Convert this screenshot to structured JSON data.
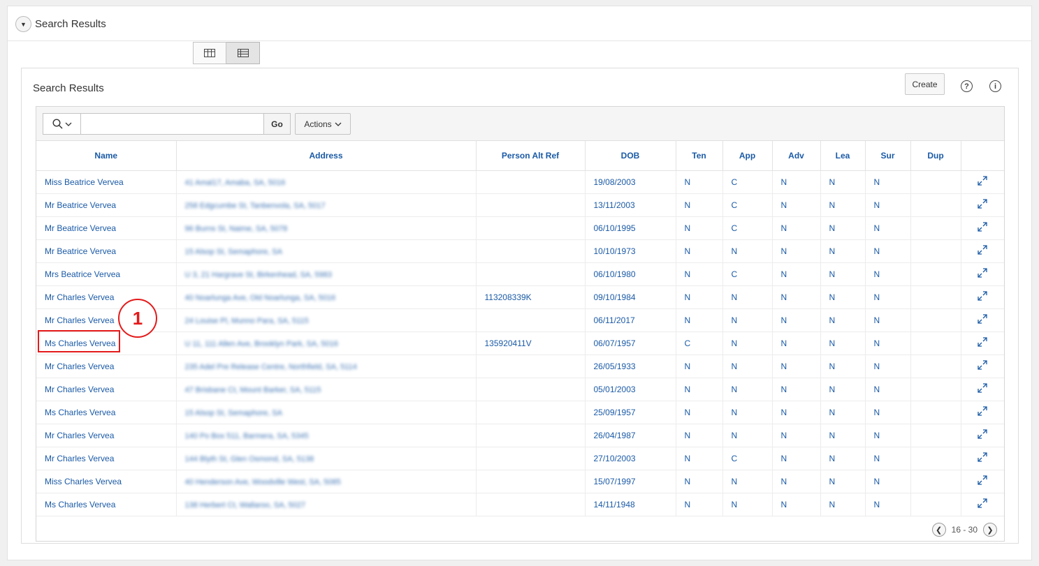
{
  "region": {
    "title": "Search Results"
  },
  "report": {
    "title": "Search Results",
    "create_label": "Create",
    "help_glyph": "?",
    "info_glyph": "i",
    "go_label": "Go",
    "actions_label": "Actions",
    "search_value": "",
    "columns": [
      "Name",
      "Address",
      "Person Alt Ref",
      "DOB",
      "Ten",
      "App",
      "Adv",
      "Lea",
      "Sur",
      "Dup",
      ""
    ],
    "rows": [
      {
        "name": "Miss Beatrice Vervea",
        "address": "41 Amal17, Amaba, SA, 5016",
        "alt_ref": "",
        "dob": "19/08/2003",
        "ten": "N",
        "app": "C",
        "adv": "N",
        "lea": "N",
        "sur": "N",
        "dup": ""
      },
      {
        "name": "Mr Beatrice Vervea",
        "address": "258 Edgcumbe St, Tanbenvola, SA, 5017",
        "alt_ref": "",
        "dob": "13/11/2003",
        "ten": "N",
        "app": "C",
        "adv": "N",
        "lea": "N",
        "sur": "N",
        "dup": ""
      },
      {
        "name": "Mr Beatrice Vervea",
        "address": "96 Burns St, Naime, SA, 5078",
        "alt_ref": "",
        "dob": "06/10/1995",
        "ten": "N",
        "app": "C",
        "adv": "N",
        "lea": "N",
        "sur": "N",
        "dup": ""
      },
      {
        "name": "Mr Beatrice Vervea",
        "address": "15 Alsop St, Semaphore, SA",
        "alt_ref": "",
        "dob": "10/10/1973",
        "ten": "N",
        "app": "N",
        "adv": "N",
        "lea": "N",
        "sur": "N",
        "dup": ""
      },
      {
        "name": "Mrs Beatrice Vervea",
        "address": "U 3, 21 Hargrave St, Birkenhead, SA, 5983",
        "alt_ref": "",
        "dob": "06/10/1980",
        "ten": "N",
        "app": "C",
        "adv": "N",
        "lea": "N",
        "sur": "N",
        "dup": ""
      },
      {
        "name": "Mr Charles Vervea",
        "address": "40 Noarlunga Ave, Old Noarlunga, SA, 5016",
        "alt_ref": "113208339K",
        "dob": "09/10/1984",
        "ten": "N",
        "app": "N",
        "adv": "N",
        "lea": "N",
        "sur": "N",
        "dup": ""
      },
      {
        "name": "Mr Charles Vervea",
        "address": "24 Louise Pl, Munno Para, SA, 5115",
        "alt_ref": "",
        "dob": "06/11/2017",
        "ten": "N",
        "app": "N",
        "adv": "N",
        "lea": "N",
        "sur": "N",
        "dup": ""
      },
      {
        "name": "Ms Charles Vervea",
        "address": "U 11, 111 Allen Ave, Brooklyn Park, SA, 5016",
        "alt_ref": "135920411V",
        "dob": "06/07/1957",
        "ten": "C",
        "app": "N",
        "adv": "N",
        "lea": "N",
        "sur": "N",
        "dup": ""
      },
      {
        "name": "Mr Charles Vervea",
        "address": "235 Adel Pre Release Centre, Northfield, SA, 5114",
        "alt_ref": "",
        "dob": "26/05/1933",
        "ten": "N",
        "app": "N",
        "adv": "N",
        "lea": "N",
        "sur": "N",
        "dup": ""
      },
      {
        "name": "Mr Charles Vervea",
        "address": "47 Brisbane Ct, Mount Barker, SA, 5115",
        "alt_ref": "",
        "dob": "05/01/2003",
        "ten": "N",
        "app": "N",
        "adv": "N",
        "lea": "N",
        "sur": "N",
        "dup": ""
      },
      {
        "name": "Ms Charles Vervea",
        "address": "15 Alsop St, Semaphore, SA",
        "alt_ref": "",
        "dob": "25/09/1957",
        "ten": "N",
        "app": "N",
        "adv": "N",
        "lea": "N",
        "sur": "N",
        "dup": ""
      },
      {
        "name": "Mr Charles Vervea",
        "address": "140 Po Box 511, Barmera, SA, 5345",
        "alt_ref": "",
        "dob": "26/04/1987",
        "ten": "N",
        "app": "N",
        "adv": "N",
        "lea": "N",
        "sur": "N",
        "dup": ""
      },
      {
        "name": "Mr Charles Vervea",
        "address": "144 Blyth St, Glen Osmond, SA, 5138",
        "alt_ref": "",
        "dob": "27/10/2003",
        "ten": "N",
        "app": "C",
        "adv": "N",
        "lea": "N",
        "sur": "N",
        "dup": ""
      },
      {
        "name": "Miss Charles Vervea",
        "address": "40 Henderson Ave, Woodville West, SA, 5085",
        "alt_ref": "",
        "dob": "15/07/1997",
        "ten": "N",
        "app": "N",
        "adv": "N",
        "lea": "N",
        "sur": "N",
        "dup": ""
      },
      {
        "name": "Ms Charles Vervea",
        "address": "138 Herbert Ct, Wallaroo, SA, 5027",
        "alt_ref": "",
        "dob": "14/11/1948",
        "ten": "N",
        "app": "N",
        "adv": "N",
        "lea": "N",
        "sur": "N",
        "dup": ""
      }
    ],
    "pagination": "16 - 30"
  },
  "annotation": {
    "number": "1",
    "color": "#e41a1a"
  },
  "icons": [
    "chevron-down-icon",
    "grid-view-icon",
    "table-view-icon",
    "search-icon",
    "help-icon",
    "info-icon",
    "expand-icon",
    "prev-page-icon",
    "next-page-icon"
  ]
}
